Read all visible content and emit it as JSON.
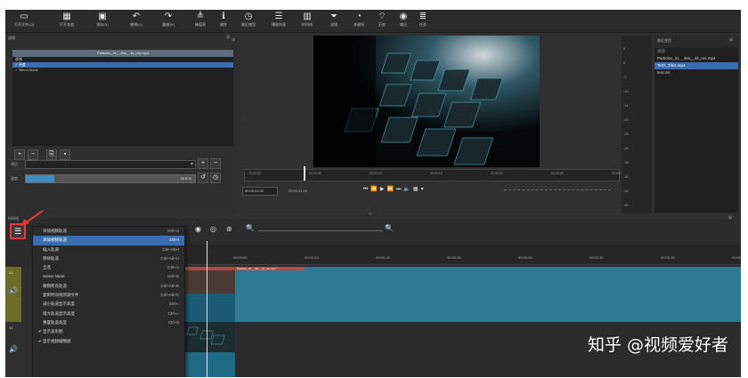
{
  "toolbar": {
    "items": [
      {
        "label": "打开文件(O)",
        "icon": "folder-open-icon",
        "glyph": "▭"
      },
      {
        "label": "打开其他",
        "icon": "open-other-icon",
        "glyph": "▦"
      },
      {
        "label": "保存(S)",
        "icon": "save-icon",
        "glyph": "▣"
      },
      {
        "label": "撤销(U)",
        "icon": "undo-icon",
        "glyph": "↶"
      },
      {
        "label": "重做(R)",
        "icon": "redo-icon",
        "glyph": "↷"
      },
      {
        "label": "峰值表",
        "icon": "peak-meter-icon",
        "glyph": "≜"
      },
      {
        "label": "属性",
        "icon": "properties-icon",
        "glyph": "ℹ"
      },
      {
        "label": "最近使用",
        "icon": "recent-icon",
        "glyph": "◷"
      },
      {
        "label": "播放列表",
        "icon": "playlist-icon",
        "glyph": "☰"
      },
      {
        "label": "时间线",
        "icon": "timeline-icon",
        "glyph": "▥"
      },
      {
        "label": "滤镜",
        "icon": "filter-icon",
        "glyph": "⏷"
      },
      {
        "label": "关键帧",
        "icon": "keyframe-icon",
        "glyph": "◔"
      },
      {
        "label": "历史",
        "icon": "history-icon",
        "glyph": "⌔"
      },
      {
        "label": "输出",
        "icon": "export-icon",
        "glyph": "◉"
      },
      {
        "label": "任务",
        "icon": "jobs-icon",
        "glyph": "≣"
      }
    ]
  },
  "filters": {
    "title": "滤镜",
    "clip_name": "Particles_31__45s__4k_res.mp4",
    "category": "视频",
    "items": [
      "亮度",
      "Blend Mode"
    ],
    "preset_label": "预设",
    "speed_label": "速度",
    "speed_value": "16.8 %"
  },
  "player": {
    "timecode": "00:00:01:02",
    "duration": "00:00:31:10",
    "ruler_ticks": [
      "00:00:00",
      "00:00:05",
      "00:00:10",
      "00:00:15",
      "00:00:20",
      "00:00:25",
      "00:00:30"
    ]
  },
  "vu_scale": [
    "3",
    "0",
    "-5",
    "-10",
    "-15",
    "-20",
    "-25",
    "-30",
    "-35",
    "-40",
    "-45",
    "-50"
  ],
  "recent": {
    "title": "最近使用",
    "search_placeholder": "搜索",
    "items": [
      {
        "name": "Particles_31__45s__4k_res.mp4",
        "selected": false
      },
      {
        "name": "Tech_Tiles.mp4",
        "selected": true
      },
      {
        "name": "test.mlt",
        "selected": false
      }
    ]
  },
  "timeline": {
    "title": "时间线",
    "ruler_ticks": [
      "00:00:00",
      "00:00:10",
      "00:00:15",
      "00:00:20",
      "00:00:25",
      "00:00:30",
      "00:00:35",
      "00:00:40"
    ],
    "tracks": [
      {
        "name": "V2"
      },
      {
        "name": "V1"
      }
    ],
    "clip_label": "Particles_31__45s__4k_res.mp4"
  },
  "menu": {
    "items": [
      {
        "label": "添加视频轨道",
        "shortcut": "Ctrl+U",
        "highlight": false,
        "check": ""
      },
      {
        "label": "添加视频轨道",
        "shortcut": "Ctrl+I",
        "highlight": true,
        "check": ""
      },
      {
        "label": "插入轨道",
        "shortcut": "Ctrl+Alt+I",
        "highlight": false,
        "check": ""
      },
      {
        "label": "移除轨道",
        "shortcut": "Ctrl+Alt+U",
        "highlight": false,
        "check": ""
      },
      {
        "label": "全选",
        "shortcut": "Ctrl+A",
        "highlight": false,
        "check": ""
      },
      {
        "label": "Select None",
        "shortcut": "Ctrl+D",
        "highlight": false,
        "check": ""
      },
      {
        "label": "撤销所有轨道",
        "shortcut": "Ctrl+Alt+R",
        "highlight": false,
        "check": ""
      },
      {
        "label": "复制时间线到源文件",
        "shortcut": "Ctrl+Alt+C",
        "highlight": false,
        "check": ""
      },
      {
        "label": "减小轨道显示高度",
        "shortcut": "Ctrl+-",
        "highlight": false,
        "check": ""
      },
      {
        "label": "增大轨道显示高度",
        "shortcut": "Ctrl+=",
        "highlight": false,
        "check": ""
      },
      {
        "label": "重置轨道高度",
        "shortcut": "Ctrl+0",
        "highlight": false,
        "check": ""
      },
      {
        "label": "显示波形图",
        "shortcut": "",
        "highlight": false,
        "check": "✔"
      },
      {
        "label": "显示视频缩略图",
        "shortcut": "",
        "highlight": false,
        "check": "✔"
      }
    ]
  },
  "watermark": "知乎 @视频爱好者"
}
